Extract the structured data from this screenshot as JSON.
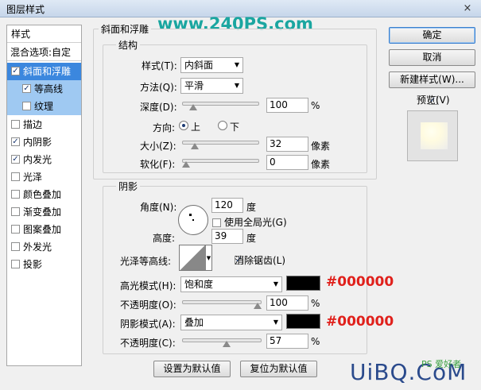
{
  "window": {
    "title": "图层样式",
    "close_icon": "×",
    "watermark": "www.240PS.com"
  },
  "styles_list": {
    "header": "样式",
    "blend_options": "混合选项:自定",
    "items": [
      {
        "label": "斜面和浮雕",
        "checked": true
      },
      {
        "label": "等高线",
        "checked": true
      },
      {
        "label": "纹理",
        "checked": false
      },
      {
        "label": "描边",
        "checked": false
      },
      {
        "label": "内阴影",
        "checked": true
      },
      {
        "label": "内发光",
        "checked": true
      },
      {
        "label": "光泽",
        "checked": false
      },
      {
        "label": "颜色叠加",
        "checked": false
      },
      {
        "label": "渐变叠加",
        "checked": false
      },
      {
        "label": "图案叠加",
        "checked": false
      },
      {
        "label": "外发光",
        "checked": false
      },
      {
        "label": "投影",
        "checked": false
      }
    ],
    "check_glyph": "✓"
  },
  "bevel": {
    "group_title": "斜面和浮雕",
    "structure_title": "结构",
    "style_label": "样式(T):",
    "style_value": "内斜面",
    "technique_label": "方法(Q):",
    "technique_value": "平滑",
    "depth_label": "深度(D):",
    "depth_value": "100",
    "depth_unit": "%",
    "depth_fraction": 0.1,
    "direction_label": "方向:",
    "direction_up": "上",
    "direction_down": "下",
    "size_label": "大小(Z):",
    "size_value": "32",
    "size_unit": "像素",
    "size_fraction": 0.13,
    "soften_label": "软化(F):",
    "soften_value": "0",
    "soften_unit": "像素",
    "soften_fraction": 0.0
  },
  "shading": {
    "title": "阴影",
    "angle_label": "角度(N):",
    "angle_value": "120",
    "angle_unit": "度",
    "global_light_label": "使用全局光(G)",
    "altitude_label": "高度:",
    "altitude_value": "39",
    "altitude_unit": "度",
    "gloss_label": "光泽等高线:",
    "antialias_label": "消除锯齿(L)",
    "highlight_mode_label": "高光模式(H):",
    "highlight_mode_value": "饱和度",
    "highlight_color": "#000000",
    "highlight_color_note": "#000000",
    "highlight_opacity_label": "不透明度(O):",
    "highlight_opacity_value": "100",
    "highlight_opacity_unit": "%",
    "highlight_opacity_fraction": 1.0,
    "shadow_mode_label": "阴影模式(A):",
    "shadow_mode_value": "叠加",
    "shadow_color": "#000000",
    "shadow_color_note": "#000000",
    "shadow_opacity_label": "不透明度(C):",
    "shadow_opacity_value": "57",
    "shadow_opacity_unit": "%",
    "shadow_opacity_fraction": 0.57
  },
  "buttons": {
    "make_default": "设置为默认值",
    "reset_default": "复位为默认值",
    "ok": "确定",
    "cancel": "取消",
    "new_style": "新建样式(W)...",
    "preview": "预览(V)"
  },
  "footer_watermark": {
    "main": "UiBQ.CoM",
    "sub": "PS 爱好者"
  },
  "icons": {
    "dropdown": "▼",
    "dropdown_glyph": "▼"
  }
}
